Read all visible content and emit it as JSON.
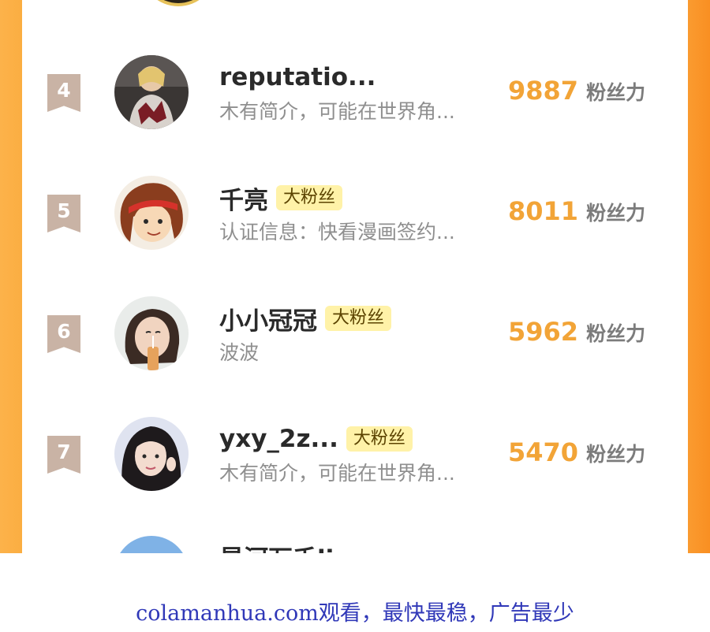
{
  "colors": {
    "accent_orange": "#f2a437",
    "frame_orange": "#fbae42",
    "rank_ribbon": "#c9b3a5",
    "badge_bg": "#fff2a8",
    "footer_link": "#3038b8"
  },
  "ranking": {
    "unit_label": "粉丝力",
    "rows": [
      {
        "rank": "4",
        "name": "reputatio...",
        "badge": "",
        "desc": "木有简介，可能在世界角...",
        "score": "9887",
        "avatar": "avatar-photo-blonde-woman"
      },
      {
        "rank": "5",
        "name": "千亮",
        "badge": "大粉丝",
        "desc": "认证信息：快看漫画签约...",
        "score": "8011",
        "avatar": "avatar-manga-girl-headband"
      },
      {
        "rank": "6",
        "name": "小小冠冠",
        "badge": "大粉丝",
        "desc": "波波",
        "score": "5962",
        "avatar": "avatar-photo-girl-drink"
      },
      {
        "rank": "7",
        "name": "yxy_2z...",
        "badge": "大粉丝",
        "desc": "木有简介，可能在世界角...",
        "score": "5470",
        "avatar": "avatar-photo-dark-hair-girl"
      }
    ],
    "partial_next_name": "星河万千lin"
  },
  "footer": {
    "text": "colamanhua.com观看，最快最稳，广告最少"
  }
}
